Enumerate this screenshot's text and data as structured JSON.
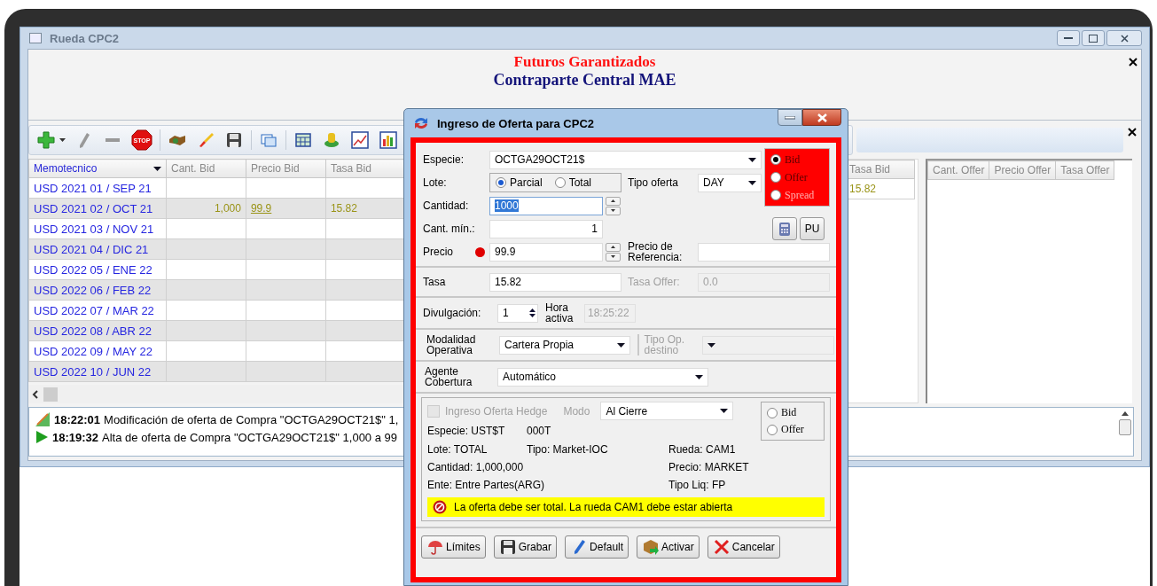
{
  "window": {
    "title": "Rueda CPC2"
  },
  "header": {
    "title": "Futuros Garantizados",
    "subtitle": "Contraparte Central MAE"
  },
  "toolbar_groups": [
    {
      "items": [
        {
          "kind": "add"
        },
        {
          "kind": "edit"
        },
        {
          "kind": "remove"
        },
        {
          "kind": "stop",
          "label": "STOP"
        }
      ]
    },
    {
      "items": [
        {
          "kind": "deal"
        },
        {
          "kind": "launch"
        },
        {
          "kind": "save"
        }
      ]
    },
    {
      "items": [
        {
          "kind": "windows"
        }
      ]
    },
    {
      "items": [
        {
          "kind": "grid"
        },
        {
          "kind": "coins"
        },
        {
          "kind": "line-chart"
        },
        {
          "kind": "bar-chart"
        }
      ]
    }
  ],
  "bid_table": {
    "columns": [
      "Memotecnico",
      "Cant. Bid",
      "Precio Bid",
      "Tasa Bid"
    ],
    "rows": [
      {
        "memotecnico": "USD 2021 01 / SEP 21"
      },
      {
        "memotecnico": "USD 2021 02 / OCT 21",
        "cant_bid": "1,000",
        "precio_bid": "99.9",
        "tasa_bid": "15.82"
      },
      {
        "memotecnico": "USD 2021 03 / NOV 21"
      },
      {
        "memotecnico": "USD 2021 04 / DIC 21"
      },
      {
        "memotecnico": "USD 2022 05 / ENE 22"
      },
      {
        "memotecnico": "USD 2022 06 / FEB 22"
      },
      {
        "memotecnico": "USD 2022 07 / MAR 22"
      },
      {
        "memotecnico": "USD 2022 08 / ABR 22"
      },
      {
        "memotecnico": "USD 2022 09 / MAY 22"
      },
      {
        "memotecnico": "USD 2022 10 / JUN 22"
      }
    ]
  },
  "book_pane": {
    "columns": [
      "Tasa Bid"
    ],
    "rows": [
      {
        "tasa_bid": "15.82"
      }
    ]
  },
  "offer_table": {
    "columns": [
      "Cant. Offer",
      "Precio Offer",
      "Tasa Offer"
    ]
  },
  "log": [
    {
      "kind": "modify",
      "time": "18:22:01",
      "text": "Modificación de oferta de Compra \"OCTGA29OCT21$\" 1,"
    },
    {
      "kind": "add",
      "time": "18:19:32",
      "text": "Alta de oferta de Compra \"OCTGA29OCT21$\" 1,000 a 99"
    }
  ],
  "dialog": {
    "title": "Ingreso de Oferta para CPC2",
    "especie": {
      "label": "Especie:",
      "value": "OCTGA29OCT21$"
    },
    "side": [
      {
        "label": "Bid",
        "selected": true,
        "disabled": false
      },
      {
        "label": "Offer",
        "selected": false,
        "disabled": false
      },
      {
        "label": "Spread",
        "selected": false,
        "disabled": true
      }
    ],
    "lote": {
      "label": "Lote:",
      "options": [
        {
          "label": "Parcial",
          "selected": true
        },
        {
          "label": "Total",
          "selected": false
        }
      ]
    },
    "tipo_oferta": {
      "label": "Tipo oferta",
      "value": "DAY"
    },
    "cantidad": {
      "label": "Cantidad:",
      "value": "1000",
      "text_selected": true
    },
    "cant_min": {
      "label": "Cant. mín.:",
      "value": "1"
    },
    "pu_button": "PU",
    "precio": {
      "label": "Precio",
      "value": "99.9",
      "status_dot": true
    },
    "precio_referencia": {
      "label": "Precio de Referencia:"
    },
    "tasa": {
      "label": "Tasa",
      "value": "15.82"
    },
    "tasa_offer": {
      "label": "Tasa Offer:",
      "value": "0.0",
      "disabled": true
    },
    "divulgacion": {
      "label": "Divulgación:",
      "value": "1"
    },
    "hora_activa": {
      "label": "Hora activa",
      "value": "18:25:22",
      "disabled": true
    },
    "modalidad": {
      "label": "Modalidad Operativa",
      "value": "Cartera Propia"
    },
    "tipo_op_destino": {
      "label": "Tipo Op. destino",
      "disabled": true
    },
    "agente": {
      "label": "Agente Cobertura",
      "value": "Automático"
    },
    "hedge": {
      "label": "Ingreso Oferta Hedge",
      "checked": false,
      "disabled": true,
      "modo_label": "Modo",
      "modo_value": "Al Cierre",
      "side": [
        {
          "label": "Bid",
          "selected": false
        },
        {
          "label": "Offer",
          "selected": false
        }
      ],
      "info": [
        {
          "left": "Especie: UST$T",
          "middle": "000T"
        },
        {
          "left": "Lote: TOTAL",
          "middle": "Tipo: Market-IOC",
          "right": "Rueda: CAM1"
        },
        {
          "left": "Cantidad: 1,000,000",
          "right": "Precio: MARKET"
        },
        {
          "left": "Ente: Entre Partes(ARG)",
          "right": "Tipo Liq: FP"
        }
      ],
      "warning": "La oferta debe ser total. La rueda CAM1 debe estar abierta"
    },
    "buttons": [
      {
        "kind": "limits",
        "label": "Límites"
      },
      {
        "kind": "save",
        "label": "Grabar"
      },
      {
        "kind": "default",
        "label": "Default"
      },
      {
        "kind": "activate",
        "label": "Activar"
      },
      {
        "kind": "cancel",
        "label": "Cancelar"
      }
    ]
  }
}
